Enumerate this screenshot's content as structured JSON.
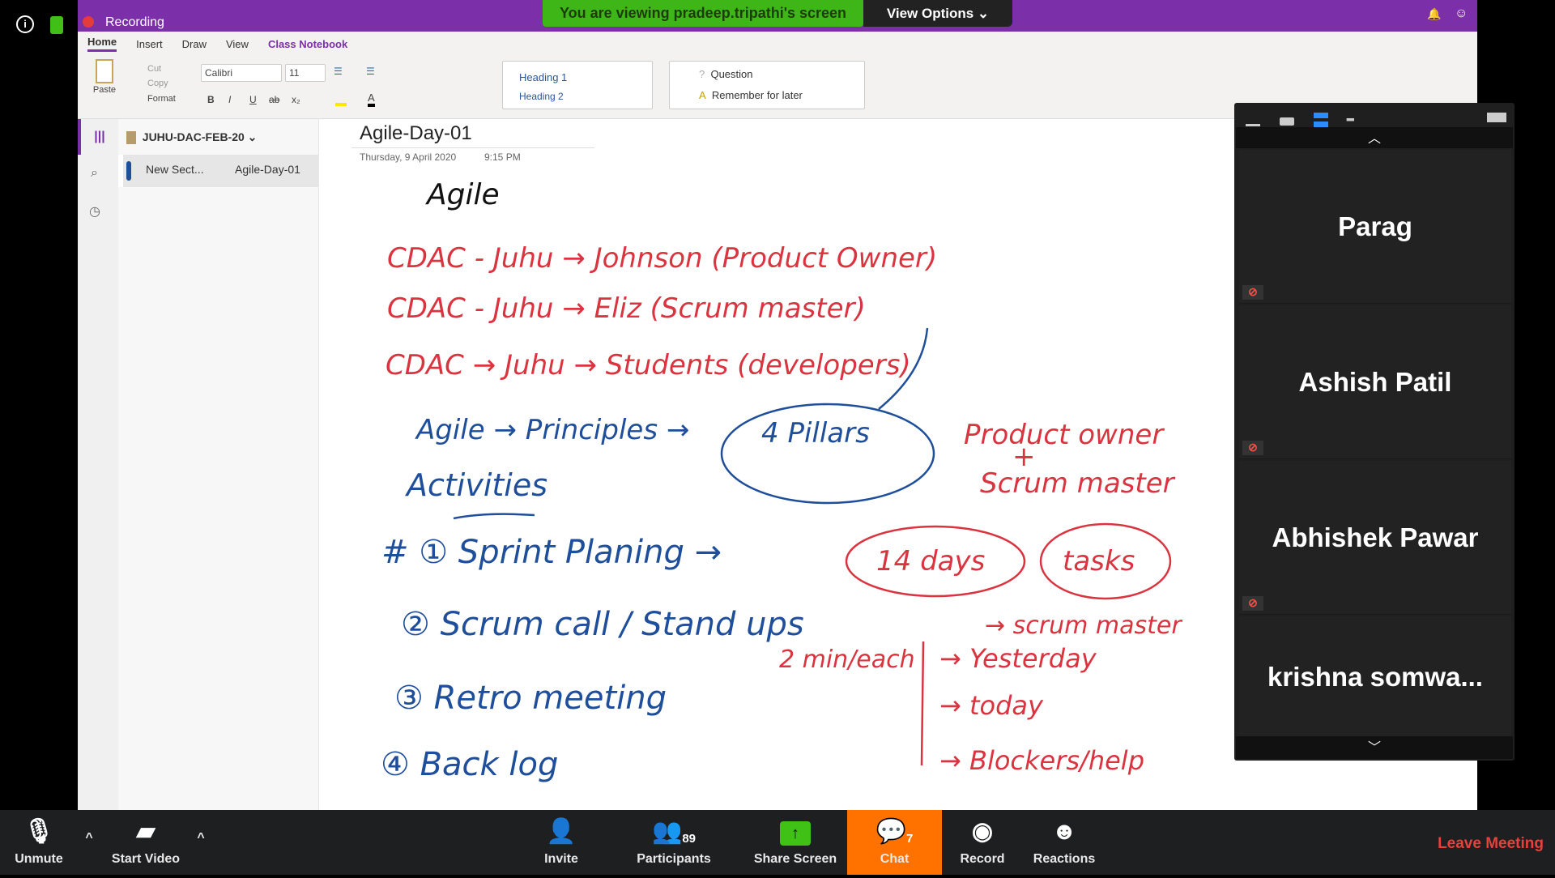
{
  "top": {
    "recording": "Recording",
    "banner": "You are viewing pradeep.tripathi's screen",
    "view_options": "View Options"
  },
  "ribbon": {
    "tabs": [
      "Home",
      "Insert",
      "Draw",
      "View",
      "Class Notebook"
    ],
    "paste": "Paste",
    "cut": "Cut",
    "copy": "Copy",
    "format": "Format",
    "font": "Calibri",
    "size": "11",
    "bold": "B",
    "italic": "I",
    "underline": "U",
    "strike": "ab",
    "sub": "x₂",
    "styles": [
      "Heading 1",
      "Heading 2"
    ],
    "tags": [
      "Question",
      "Remember for later"
    ]
  },
  "notebook": {
    "name": "JUHU-DAC-FEB-20",
    "section": "New Sect...",
    "page": "Agile-Day-01"
  },
  "page": {
    "title": "Agile-Day-01",
    "date": "Thursday, 9 April 2020",
    "time": "9:15 PM"
  },
  "ink": {
    "heading": "Agile",
    "l1": "CDAC - Juhu → Johnson (Product Owner)",
    "l2": "CDAC - Juhu → Eliz (Scrum master)",
    "l3": "CDAC → Juhu → Students (developers)",
    "l4": "Agile → Principles →",
    "pillars": "4 Pillars",
    "po": "Product owner",
    "plus": "+",
    "sm": "Scrum master",
    "activities": "Activities",
    "a1": "# ① Sprint Planing →",
    "days": "14 days",
    "tasks": "tasks",
    "a2": "②    Scrum call / Stand ups",
    "a2b": "→ scrum master",
    "each": "2 min/each",
    "y": "→ Yesterday",
    "t": "→ today",
    "b": "→ Blockers/help",
    "a3": "③       Retro   meeting",
    "a4": "④       Back log"
  },
  "participants": [
    "Parag",
    "Ashish Patil",
    "Abhishek Pawar",
    "krishna  somwa..."
  ],
  "toolbar": {
    "unmute": "Unmute",
    "video": "Start Video",
    "invite": "Invite",
    "participants": "Participants",
    "participants_count": "89",
    "share": "Share Screen",
    "chat": "Chat",
    "chat_count": "7",
    "record": "Record",
    "reactions": "Reactions",
    "leave": "Leave Meeting"
  },
  "colors": {
    "purple": "#7b2fa8",
    "green": "#3fb618",
    "chat": "#ff7200",
    "ink_red": "#d9343f",
    "ink_blue": "#1f4e9a",
    "leave": "#e8413b"
  }
}
